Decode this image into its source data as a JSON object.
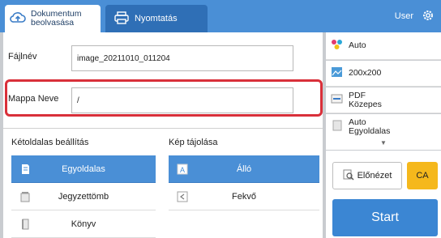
{
  "tabs": {
    "scan": {
      "label_line1": "Dokumentum",
      "label_line2": "beolvasása",
      "icon": "cloud-upload-icon"
    },
    "print": {
      "label": "Nyomtatás",
      "icon": "printer-icon"
    }
  },
  "header": {
    "user": "User",
    "settings_icon": "gear-icon"
  },
  "form": {
    "file_name": {
      "label": "Fájlnév",
      "value": "image_20211010_011204"
    },
    "folder_name": {
      "label": "Mappa Neve",
      "value": "/"
    }
  },
  "duplex": {
    "title": "Kétoldalas beállítás",
    "options": [
      {
        "label": "Egyoldalas",
        "icon": "single-page-icon",
        "selected": true
      },
      {
        "label": "Jegyzettömb",
        "icon": "notepad-icon",
        "selected": false
      },
      {
        "label": "Könyv",
        "icon": "book-icon",
        "selected": false
      }
    ]
  },
  "orientation": {
    "title": "Kép tájolása",
    "options": [
      {
        "label": "Álló",
        "icon": "portrait-icon",
        "selected": true
      },
      {
        "label": "Fekvő",
        "icon": "landscape-icon",
        "selected": false
      }
    ]
  },
  "side_settings": {
    "color_mode": "Auto",
    "resolution": "200x200",
    "format_line1": "PDF",
    "format_line2": "Közepes",
    "scan_side_line1": "Auto",
    "scan_side_line2": "Egyoldalas"
  },
  "actions": {
    "preview": "Előnézet",
    "clear": "CA",
    "start": "Start"
  },
  "colors": {
    "accent": "#4a8fd6",
    "highlight_border": "#d9303a",
    "clear_button": "#f5b81c",
    "start_button": "#3b86d3"
  }
}
